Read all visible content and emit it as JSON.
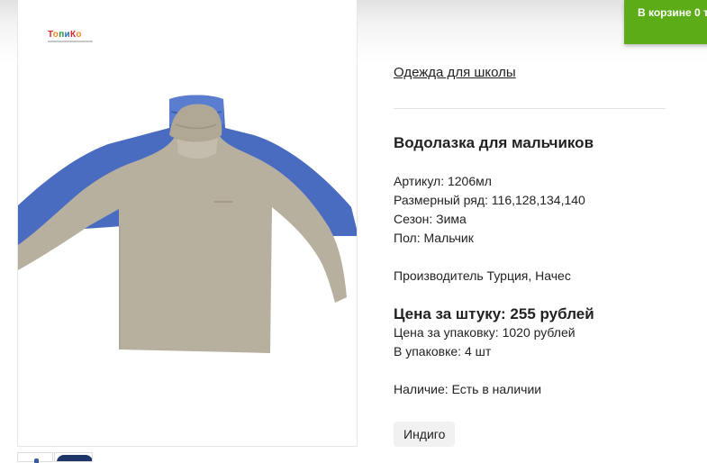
{
  "cart": {
    "label": "В корзине 0 т"
  },
  "product_image": {
    "brand_logo_text": "ТопиКо"
  },
  "breadcrumb": {
    "link": "Одежда для школы"
  },
  "product": {
    "title": "Водолазка для мальчиков",
    "specs": [
      "Артикул: 1206мл",
      "Размерный ряд: 116,128,134,140",
      "Сезон: Зима",
      "Пол: Мальчик"
    ],
    "manufacturer": "Производитель Турция, Начес",
    "price_per_piece": "Цена за штуку: 255 рублей",
    "price_per_pack": "Цена за упаковку: 1020 рублей",
    "pack_quantity": "В упаковке: 4 шт",
    "availability": "Наличие: Есть в наличии",
    "color_option": "Индиго"
  },
  "colors": {
    "cart_bg": "#5cac17",
    "shirt_back": "#4a6cc0",
    "shirt_front": "#b8b09f"
  }
}
